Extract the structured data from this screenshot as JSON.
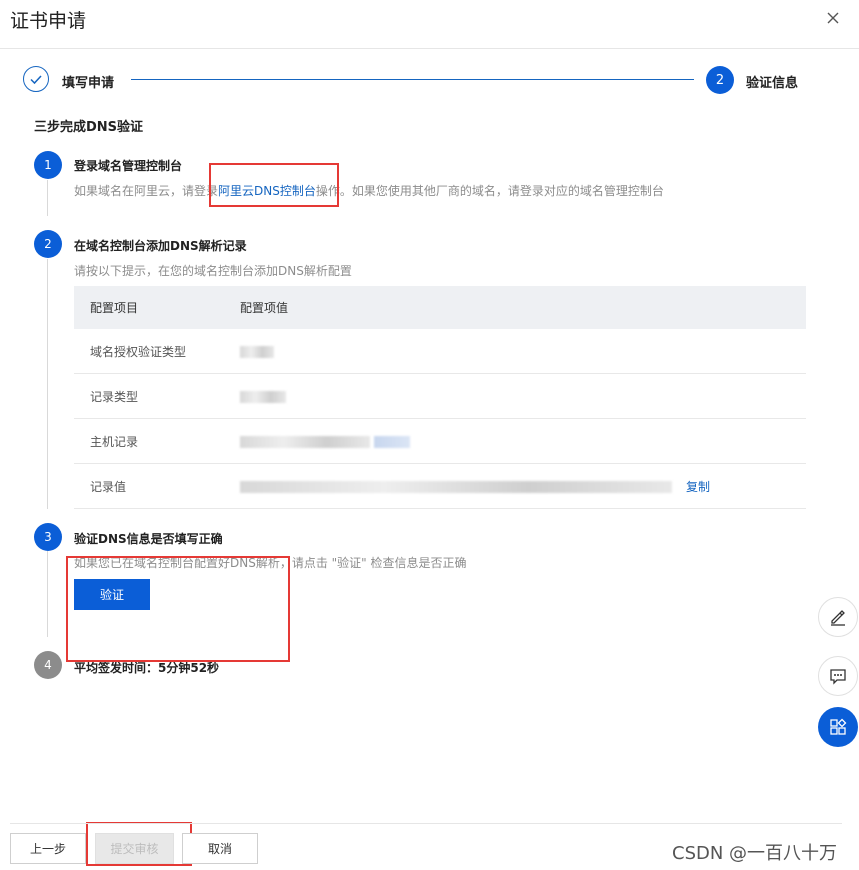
{
  "dialog": {
    "title": "证书申请"
  },
  "steps": {
    "step1_label": "填写申请",
    "step2_number": "2",
    "step2_label": "验证信息"
  },
  "section_title": "三步完成DNS验证",
  "items": [
    {
      "number": "1",
      "title": "登录域名管理控制台",
      "desc_prefix": "如果域名在阿里云，请登录",
      "desc_link": "阿里云DNS控制台",
      "desc_suffix": "操作。如果您使用其他厂商的域名，请登录对应的域名管理控制台"
    },
    {
      "number": "2",
      "title": "在域名控制台添加DNS解析记录",
      "desc": "请按以下提示，在您的域名控制台添加DNS解析配置"
    },
    {
      "number": "3",
      "title": "验证DNS信息是否填写正确",
      "desc": "如果您已在域名控制台配置好DNS解析，请点击 \"验证\" 检查信息是否正确",
      "button": "验证"
    },
    {
      "number": "4",
      "title": "平均签发时间：5分钟52秒"
    }
  ],
  "table": {
    "headers": [
      "配置项目",
      "配置项值"
    ],
    "rows": [
      {
        "label": "域名授权验证类型"
      },
      {
        "label": "记录类型"
      },
      {
        "label": "主机记录"
      },
      {
        "label": "记录值",
        "action": "复制"
      }
    ]
  },
  "footer": {
    "prev": "上一步",
    "submit": "提交审核",
    "cancel": "取消"
  },
  "watermark": "CSDN @一百八十万",
  "icons": {
    "close": "close-icon",
    "check": "check-icon",
    "edit": "edit-icon",
    "feedback": "feedback-icon",
    "apps": "apps-icon"
  },
  "colors": {
    "accent": "#0b5ed7",
    "highlight": "#e53935"
  }
}
